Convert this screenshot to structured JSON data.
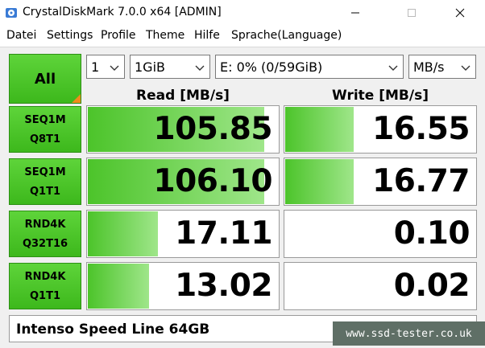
{
  "window": {
    "title": "CrystalDiskMark 7.0.0 x64 [ADMIN]",
    "app_icon": "crystaldiskmark-icon",
    "controls": [
      "minimize-icon",
      "maximize-icon",
      "close-icon"
    ]
  },
  "menu": {
    "items": [
      "Datei",
      "Settings",
      "Profile",
      "Theme",
      "Hilfe",
      "Sprache(Language)"
    ]
  },
  "toolbar": {
    "all_label": "All",
    "count_value": "1",
    "size_value": "1GiB",
    "drive_value": "E: 0% (0/59GiB)",
    "unit_value": "MB/s"
  },
  "headers": {
    "read": "Read [MB/s]",
    "write": "Write [MB/s]"
  },
  "tests": [
    {
      "line1": "SEQ1M",
      "line2": "Q8T1",
      "read": "105.85",
      "write": "16.55",
      "read_fill": 0.93,
      "write_fill": 0.36
    },
    {
      "line1": "SEQ1M",
      "line2": "Q1T1",
      "read": "106.10",
      "write": "16.77",
      "read_fill": 0.93,
      "write_fill": 0.36
    },
    {
      "line1": "RND4K",
      "line2": "Q32T16",
      "read": "17.11",
      "write": "0.10",
      "read_fill": 0.37,
      "write_fill": 0.0
    },
    {
      "line1": "RND4K",
      "line2": "Q1T1",
      "read": "13.02",
      "write": "0.02",
      "read_fill": 0.32,
      "write_fill": 0.0
    }
  ],
  "comment": "Intenso Speed Line 64GB",
  "watermark": "www.ssd-tester.co.uk",
  "colors": {
    "accent_green": "#3db81c",
    "bar_green": "#4cc42a",
    "corner_orange": "#f08a1c"
  }
}
